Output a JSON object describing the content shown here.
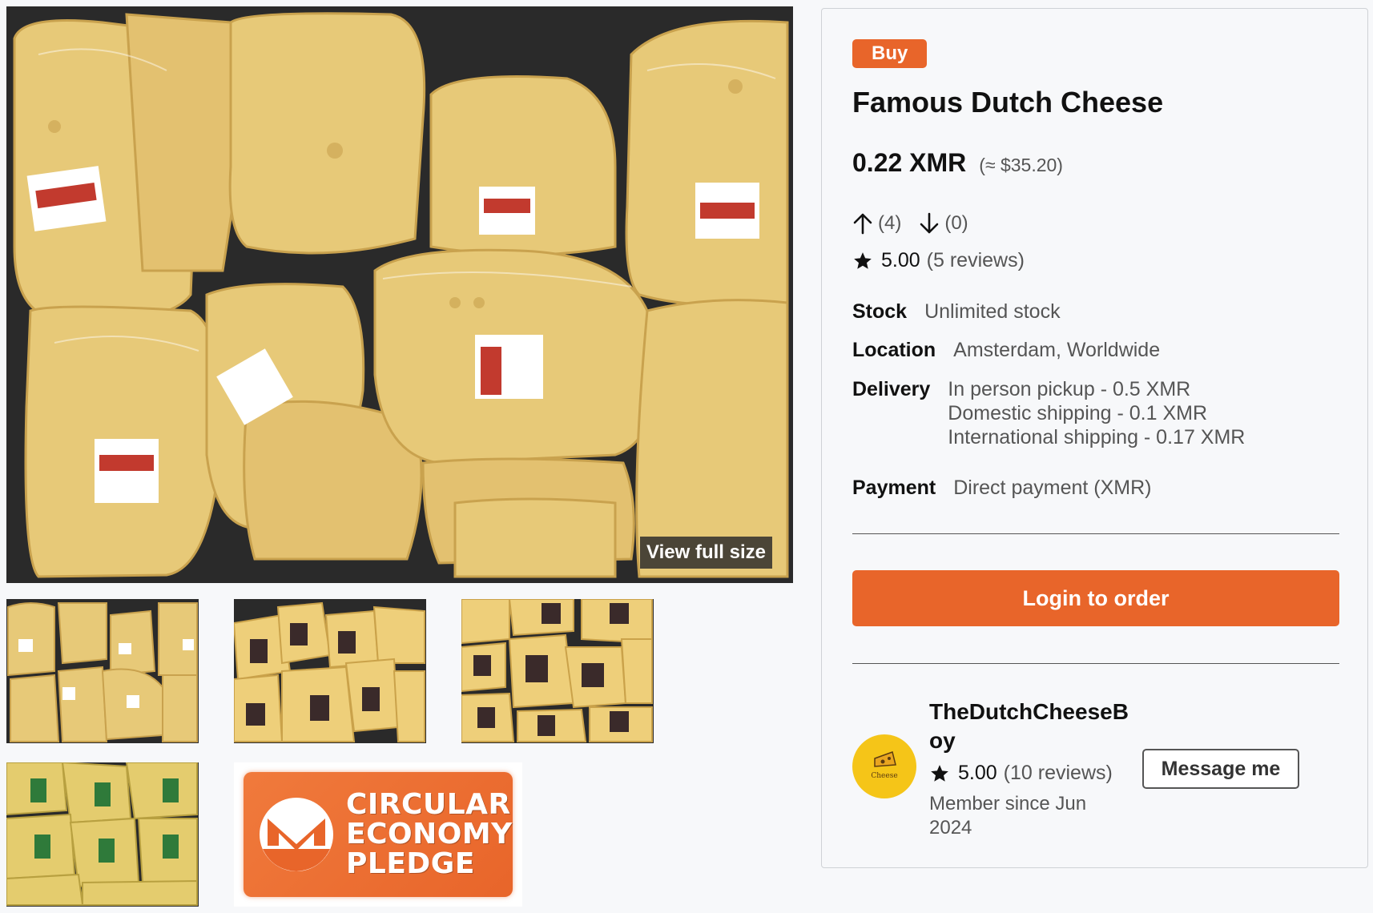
{
  "gallery": {
    "view_full_size": "View full size",
    "pledge": {
      "line1": "CIRCULAR",
      "line2": "ECONOMY",
      "line3": "PLEDGE"
    }
  },
  "product": {
    "badge": "Buy",
    "title": "Famous Dutch Cheese",
    "price": "0.22 XMR",
    "price_fiat": "(≈ $35.20)",
    "upvotes": "(4)",
    "downvotes": "(0)",
    "rating": "5.00",
    "reviews": "(5 reviews)",
    "stock_label": "Stock",
    "stock_value": "Unlimited stock",
    "location_label": "Location",
    "location_value": "Amsterdam, Worldwide",
    "delivery_label": "Delivery",
    "delivery_options": [
      "In person pickup - 0.5 XMR",
      "Domestic shipping - 0.1 XMR",
      "International shipping - 0.17 XMR"
    ],
    "payment_label": "Payment",
    "payment_value": "Direct payment (XMR)",
    "order_button": "Login to order"
  },
  "seller": {
    "name": "TheDutchCheeseBoy",
    "rating": "5.00",
    "reviews": "(10 reviews)",
    "member_since": "Member since Jun 2024",
    "avatar_text": "Cheese",
    "message_button": "Message me"
  },
  "colors": {
    "accent": "#e8652a",
    "cheese": "#e9c97a",
    "avatar_bg": "#f5c518"
  }
}
